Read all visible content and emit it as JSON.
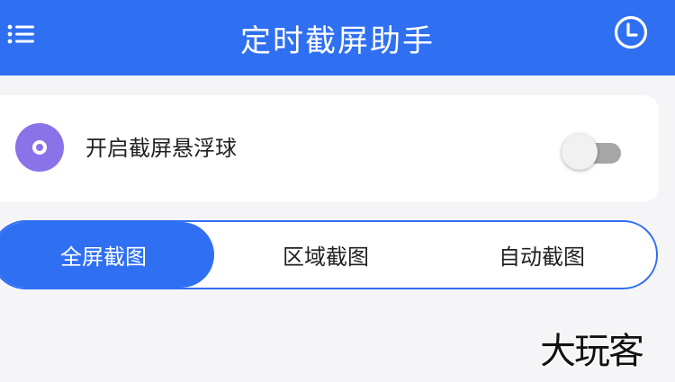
{
  "app_bar": {
    "title": "定时截屏助手",
    "menu_icon": "list-menu-icon",
    "clock_icon": "clock-icon",
    "background": "#2f6ff2"
  },
  "float_ball": {
    "label": "开启截屏悬浮球",
    "icon": "target-circle-icon",
    "icon_color": "#8a73e8",
    "enabled": false
  },
  "capture_modes": {
    "selected_index": 0,
    "items": [
      {
        "label": "全屏截图"
      },
      {
        "label": "区域截图"
      },
      {
        "label": "自动截图"
      }
    ]
  },
  "watermark": {
    "text": "大玩客"
  }
}
